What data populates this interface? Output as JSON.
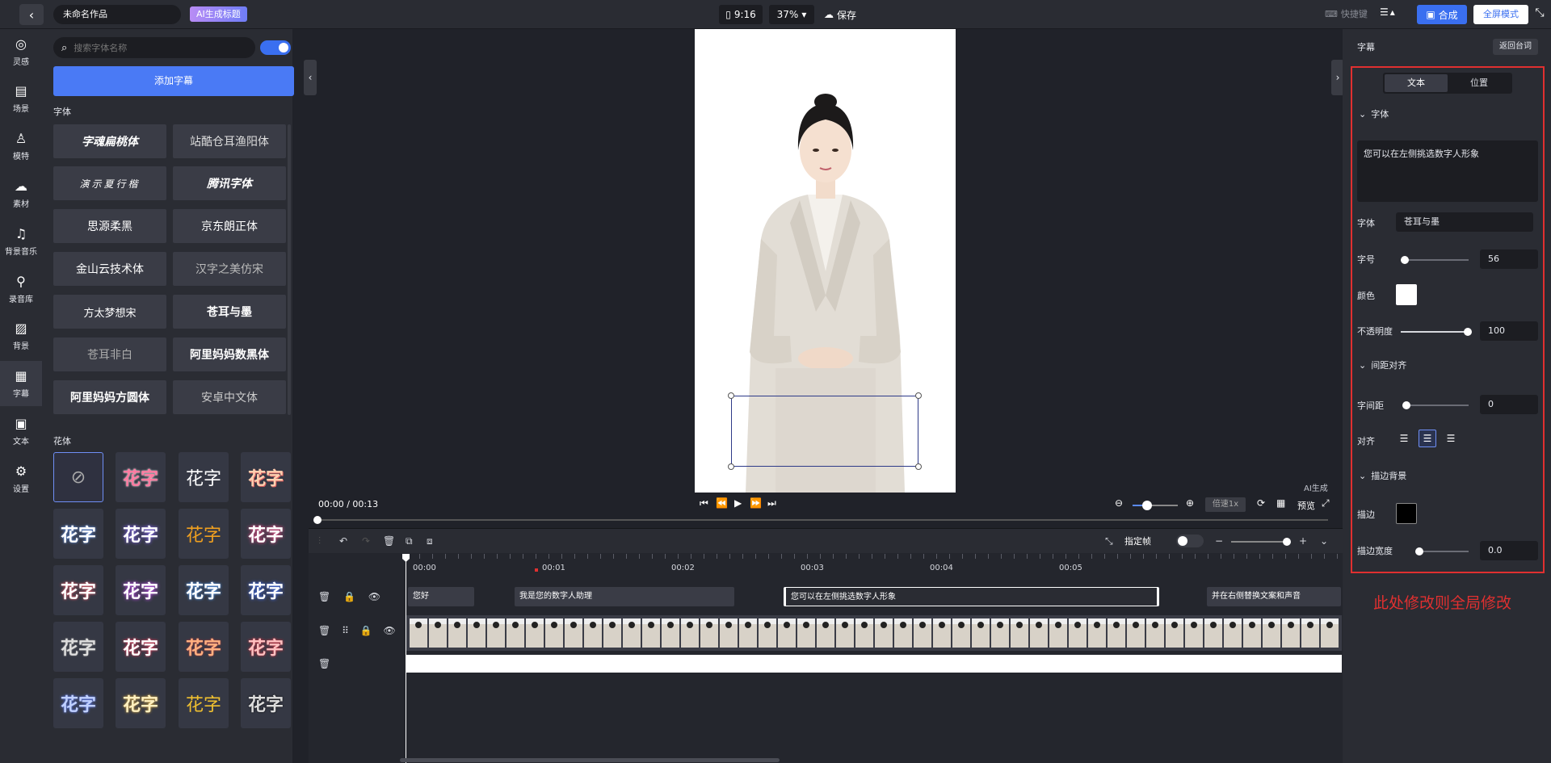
{
  "topbar": {
    "back_icon": "chevron-left-icon",
    "project_title": "未命名作品",
    "ai_title_button": "AI生成标题",
    "ratio": "9:16",
    "zoom": "37%",
    "save": "保存",
    "shortcuts": "快捷键",
    "compose": "合成",
    "fullscreen": "全屏模式"
  },
  "leftnav": [
    {
      "label": "灵感",
      "icon": "bulb-icon"
    },
    {
      "label": "场景",
      "icon": "scene-icon"
    },
    {
      "label": "模特",
      "icon": "model-icon"
    },
    {
      "label": "素材",
      "icon": "cloud-icon"
    },
    {
      "label": "背景音乐",
      "icon": "music-icon"
    },
    {
      "label": "录音库",
      "icon": "mic-icon"
    },
    {
      "label": "背景",
      "icon": "background-icon"
    },
    {
      "label": "字幕",
      "icon": "subtitle-icon"
    },
    {
      "label": "文本",
      "icon": "text-icon"
    },
    {
      "label": "设置",
      "icon": "gear-icon"
    }
  ],
  "leftpanel": {
    "search_placeholder": "搜索字体名称",
    "add_subtitle": "添加字幕",
    "fonts_heading": "字体",
    "fonts": [
      "字魂扁桃体",
      "站酷仓耳渔阳体",
      "演示夏行楷",
      "腾讯字体",
      "思源柔黑",
      "京东朗正体",
      "金山云技术体",
      "汉字之美仿宋",
      "方太梦想宋",
      "苍耳与墨",
      "苍耳非白",
      "阿里妈妈数黑体",
      "阿里妈妈方圆体",
      "安卓中文体"
    ],
    "flower_heading": "花体",
    "flower_text": "花字"
  },
  "player": {
    "timecode": "00:00 / 00:13",
    "speed": "倍速1x",
    "preview": "预览",
    "ai_generated": "AI生成"
  },
  "timeline": {
    "keyframe_label": "指定帧",
    "ticks": [
      "00:00",
      "00:01",
      "00:02",
      "00:03",
      "00:04",
      "00:05"
    ],
    "captions": [
      "您好",
      "我是您的数字人助理",
      "您可以在左侧挑选数字人形象",
      "并在右侧替换文案和声音"
    ]
  },
  "rightpanel": {
    "title": "字幕",
    "return_button": "返回台词",
    "tab_text": "文本",
    "tab_position": "位置",
    "font_section": "字体",
    "text_value": "您可以在左侧挑选数字人形象",
    "font_label": "字体",
    "font_value": "苍耳与墨",
    "size_label": "字号",
    "size_value": "56",
    "color_label": "颜色",
    "opacity_label": "不透明度",
    "opacity_value": "100",
    "spacing_section": "间距对齐",
    "letter_spacing_label": "字间距",
    "letter_spacing_value": "0",
    "align_label": "对齐",
    "stroke_section": "描边背景",
    "stroke_label": "描边",
    "stroke_width_label": "描边宽度",
    "stroke_width_value": "0.0",
    "global_note": "此处修改则全局修改"
  },
  "colors": {
    "accent": "#3a6ff0",
    "text_color": "#ffffff",
    "stroke_color": "#000000",
    "note_red": "#e03030"
  }
}
